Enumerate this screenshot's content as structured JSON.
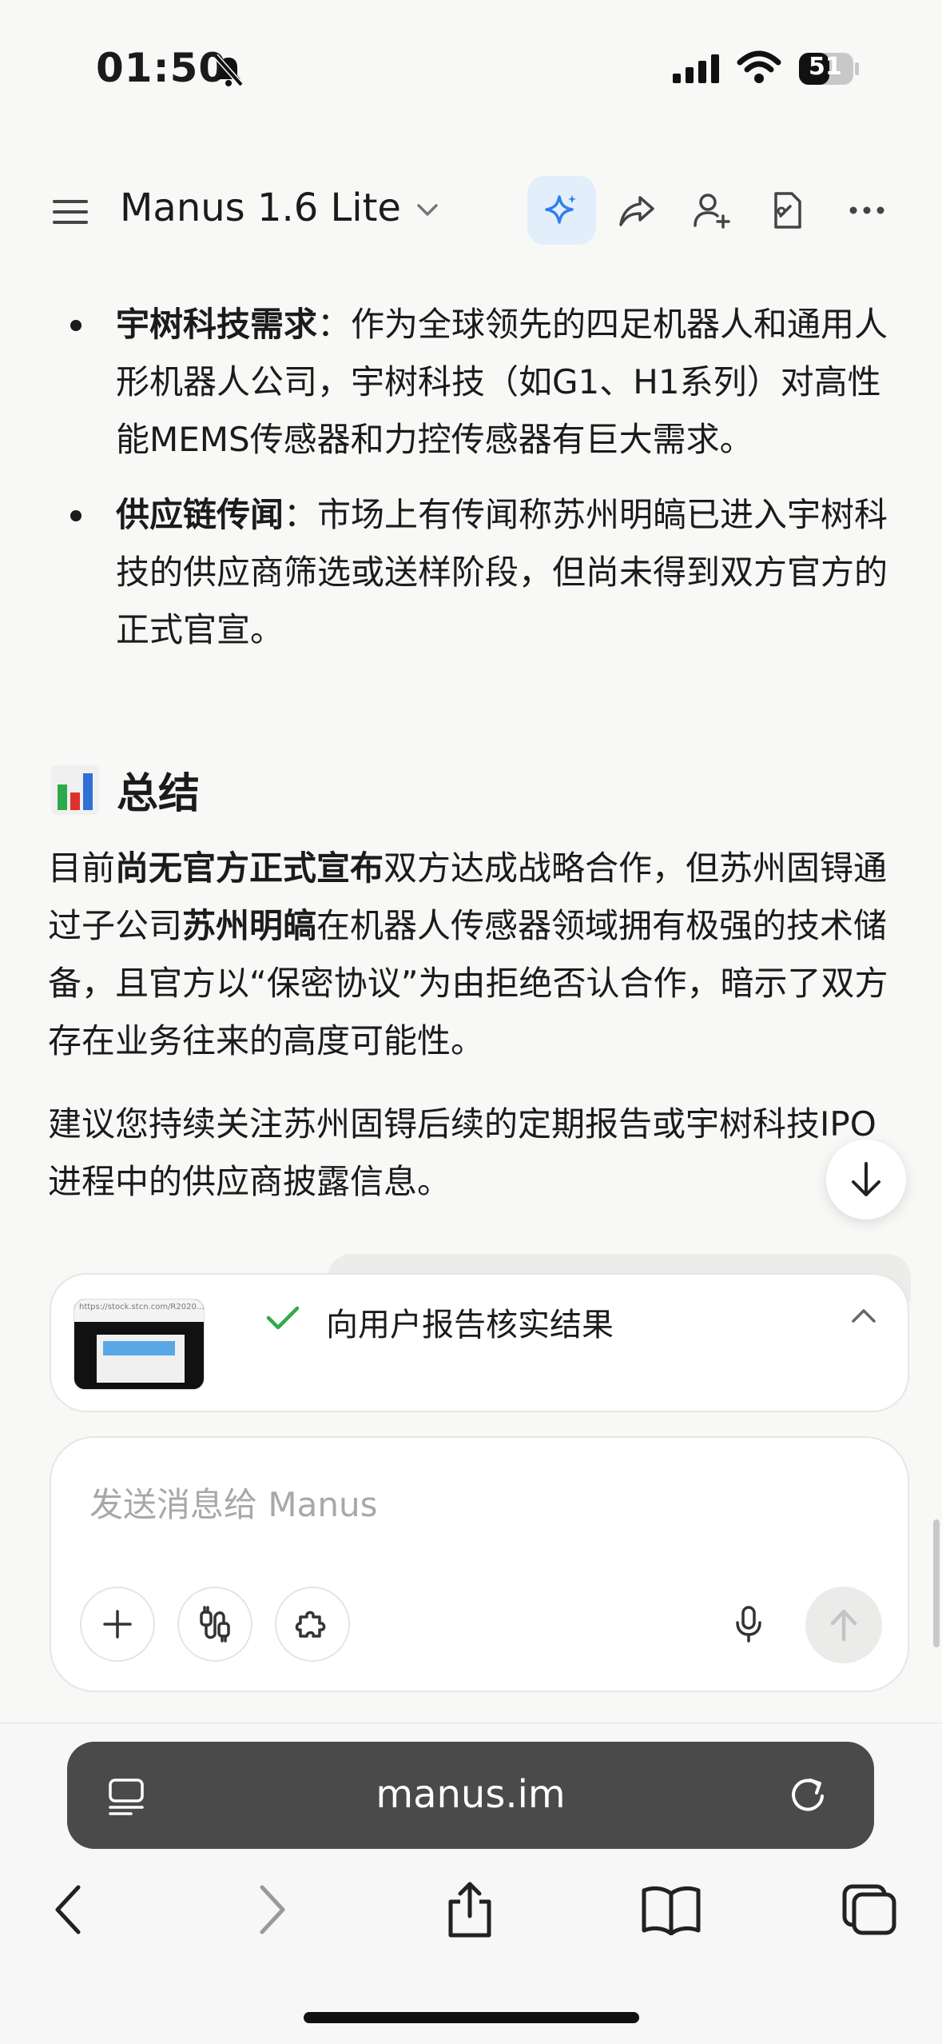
{
  "status": {
    "time": "01:50",
    "battery": "51"
  },
  "appbar": {
    "title": "Manus 1.6 Lite"
  },
  "content": {
    "bullets": [
      {
        "bold": "宇树科技需求",
        "text": "：作为全球领先的四足机器人和通用人形机器人公司，宇树科技（如G1、H1系列）对高性能MEMS传感器和力控传感器有巨大需求。"
      },
      {
        "bold": "供应链传闻",
        "text": "：市场上有传闻称苏州明皜已进入宇树科技的供应商筛选或送样阶段，但尚未得到双方官方的正式官宣。"
      }
    ],
    "section_title": "总结",
    "para1": {
      "a": "目前",
      "b": "尚无官方正式宣布",
      "c": "双方达成战略合作，但苏州固锝通过子公司",
      "d": "苏州明皜",
      "e": "在机器人传感器领域拥有极强的技术储备，且官方以“保密协议”为由拒绝否认合作，暗示了双方存在业务往来的高度可能性。"
    },
    "para2": "建议您持续关注苏州固锝后续的定期报告或宇树科技IPO进程中的供应商披露信息。"
  },
  "task": {
    "thumb_url": "https://stock.stcn.com/R2020...",
    "label": "向用户报告核实结果"
  },
  "composer": {
    "placeholder": "发送消息给 Manus"
  },
  "browser": {
    "url": "manus.im"
  },
  "colors": {
    "accent": "#2f80ed",
    "check": "#2eaa4a"
  }
}
